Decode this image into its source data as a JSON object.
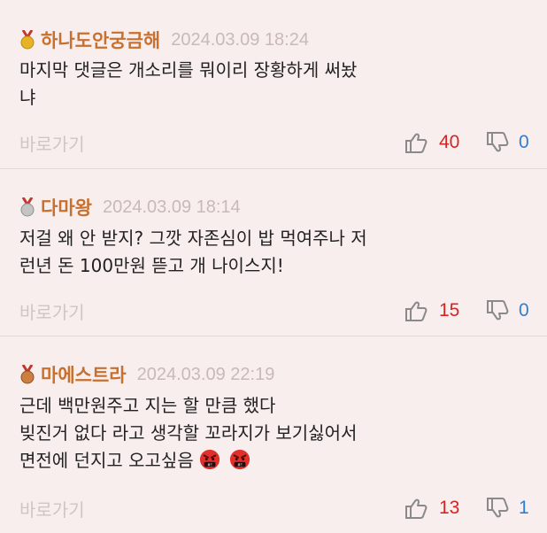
{
  "comments": [
    {
      "nickname": "하나도안궁금해",
      "medal": "gold",
      "date": "2024.03.09 18:24",
      "lines": [
        "마지막 댓글은 개소리를 뭐이리 장황하게 써놨",
        "냐"
      ],
      "goto_label": "바로가기",
      "upvotes": "40",
      "downvotes": "0"
    },
    {
      "nickname": "다마왕",
      "medal": "silver",
      "date": "2024.03.09 18:14",
      "lines": [
        "저걸 왜 안 받지? 그깟 자존심이 밥 먹여주나 저",
        "런년 돈 100만원 뜯고 개 나이스지!"
      ],
      "goto_label": "바로가기",
      "upvotes": "15",
      "downvotes": "0"
    },
    {
      "nickname": "마에스트라",
      "medal": "bronze",
      "date": "2024.03.09 22:19",
      "lines": [
        "근데 백만원주고 지는 할 만큼 했다",
        "빚진거 없다 라고 생각할 꼬라지가 보기싫어서",
        "면전에 던지고 오고싶음"
      ],
      "emojis": [
        "angry-face-icon",
        "angry-face-icon"
      ],
      "goto_label": "바로가기",
      "upvotes": "13",
      "downvotes": "1"
    }
  ],
  "colors": {
    "background": "#f9eeee",
    "nickname": "#c8702e",
    "date": "#c9b9b9",
    "upvote": "#d62424",
    "downvote": "#2a7fd6",
    "goto": "#d2c4c4"
  }
}
